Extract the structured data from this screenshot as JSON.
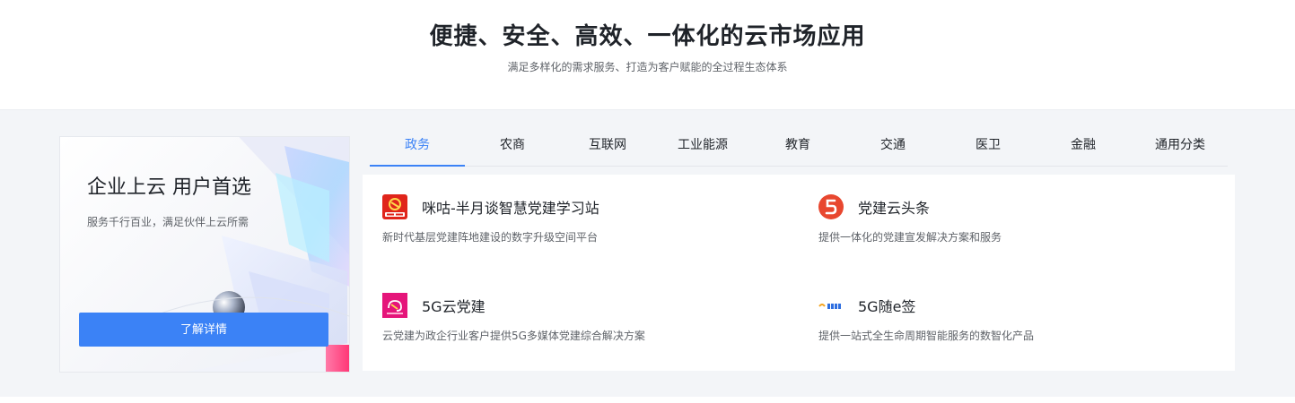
{
  "header": {
    "title": "便捷、安全、高效、一体化的云市场应用",
    "subtitle": "满足多样化的需求服务、打造为客户赋能的全过程生态体系"
  },
  "promo": {
    "title": "企业上云 用户首选",
    "subtitle": "服务千行百业，满足伙伴上云所需",
    "button_label": "了解详情"
  },
  "tabs": [
    {
      "label": "政务",
      "active": true
    },
    {
      "label": "农商",
      "active": false
    },
    {
      "label": "互联网",
      "active": false
    },
    {
      "label": "工业能源",
      "active": false
    },
    {
      "label": "教育",
      "active": false
    },
    {
      "label": "交通",
      "active": false
    },
    {
      "label": "医卫",
      "active": false
    },
    {
      "label": "金融",
      "active": false
    },
    {
      "label": "通用分类",
      "active": false
    }
  ],
  "products": [
    {
      "title": "咪咕-半月谈智慧党建学习站",
      "description": "新时代基层党建阵地建设的数字升级空间平台",
      "icon": "migu-party-logo-icon"
    },
    {
      "title": "党建云头条",
      "description": "提供一体化的党建宣发解决方案和服务",
      "icon": "party-headline-logo-icon"
    },
    {
      "title": "5G云党建",
      "description": "云党建为政企行业客户提供5G多媒体党建综合解决方案",
      "icon": "5g-cloud-party-logo-icon"
    },
    {
      "title": "5G随e签",
      "description": "提供一站式全生命周期智能服务的数智化产品",
      "icon": "5g-sign-logo-icon"
    }
  ],
  "colors": {
    "accent": "#3b82f6",
    "page_background": "#f3f5f8",
    "text_primary": "#1f2329",
    "text_secondary": "#5f6369"
  }
}
